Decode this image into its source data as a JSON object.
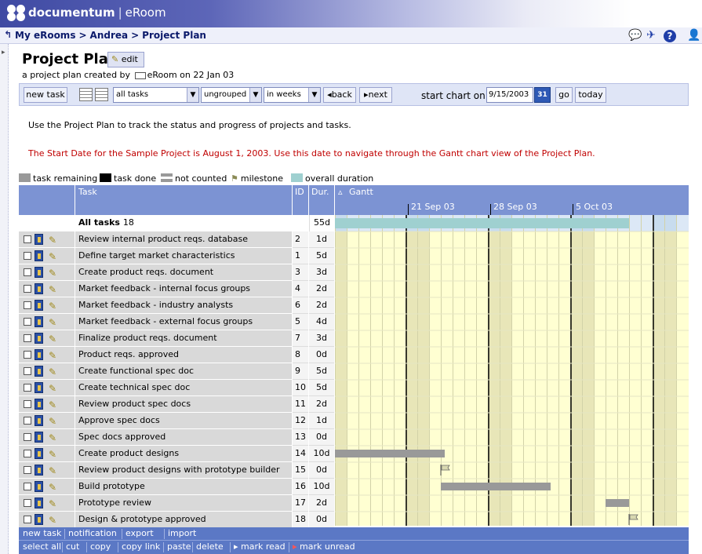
{
  "app": {
    "brand": "documentum",
    "product": "eRoom"
  },
  "nav": {
    "crumbs": [
      "My eRooms",
      "Andrea",
      "Project Plan"
    ]
  },
  "page": {
    "title": "Project Plan",
    "edit_label": "edit",
    "subtitle_prefix": "a project plan created by",
    "subtitle_author": "eRoom",
    "subtitle_suffix": "on 22 Jan 03",
    "intro": "Use the Project Plan to track the status and progress of projects and tasks.",
    "note": "The Start Date for the Sample Project is August 1, 2003.  Use this date to navigate through the Gantt chart view of the Project Plan."
  },
  "toolbar": {
    "new_task": "new task",
    "filter_value": "all tasks",
    "group_value": "ungrouped",
    "scale_value": "in weeks",
    "back": "back",
    "next": "next",
    "start_label": "start chart on",
    "start_date": "9/15/2003",
    "calendar_day": "31",
    "go": "go",
    "today": "today"
  },
  "legend": [
    {
      "label": "task remaining",
      "color": "#999999"
    },
    {
      "label": "task done",
      "color": "#000000"
    },
    {
      "label": "not counted",
      "color": "#999999"
    },
    {
      "label": "milestone",
      "color": "#b8b890"
    },
    {
      "label": "overall duration",
      "color": "#9fd0d0"
    }
  ],
  "table": {
    "headers": {
      "task": "Task",
      "id": "ID",
      "dur": "Dur.",
      "gantt": "Gantt"
    },
    "week_labels": [
      "21 Sep 03",
      "28 Sep 03",
      "5 Oct 03"
    ],
    "summary": {
      "label": "All tasks",
      "count": "18",
      "dur": "55d"
    },
    "rows": [
      {
        "name": "Review internal product reqs. database",
        "id": "2",
        "dur": "1d"
      },
      {
        "name": "Define target market characteristics",
        "id": "1",
        "dur": "5d"
      },
      {
        "name": "Create product reqs. document",
        "id": "3",
        "dur": "3d"
      },
      {
        "name": "Market feedback - internal focus groups",
        "id": "4",
        "dur": "2d"
      },
      {
        "name": "Market feedback - industry analysts",
        "id": "6",
        "dur": "2d"
      },
      {
        "name": "Market feedback - external focus groups",
        "id": "5",
        "dur": "4d"
      },
      {
        "name": "Finalize product reqs. document",
        "id": "7",
        "dur": "3d"
      },
      {
        "name": "Product reqs. approved",
        "id": "8",
        "dur": "0d"
      },
      {
        "name": "Create functional spec doc",
        "id": "9",
        "dur": "5d"
      },
      {
        "name": "Create technical spec doc",
        "id": "10",
        "dur": "5d"
      },
      {
        "name": "Review product spec docs",
        "id": "11",
        "dur": "2d"
      },
      {
        "name": "Approve spec docs",
        "id": "12",
        "dur": "1d"
      },
      {
        "name": "Spec docs approved",
        "id": "13",
        "dur": "0d"
      },
      {
        "name": "Create product designs",
        "id": "14",
        "dur": "10d"
      },
      {
        "name": "Review product designs with prototype builder",
        "id": "15",
        "dur": "0d"
      },
      {
        "name": "Build prototype",
        "id": "16",
        "dur": "10d"
      },
      {
        "name": "Prototype review",
        "id": "17",
        "dur": "2d"
      },
      {
        "name": "Design & prototype approved",
        "id": "18",
        "dur": "0d"
      }
    ]
  },
  "bottom": {
    "row1": [
      "new task",
      "notification",
      "export",
      "import"
    ],
    "row2": [
      "select all",
      "cut",
      "copy",
      "copy link",
      "paste",
      "delete",
      "mark read",
      "mark unread"
    ]
  }
}
